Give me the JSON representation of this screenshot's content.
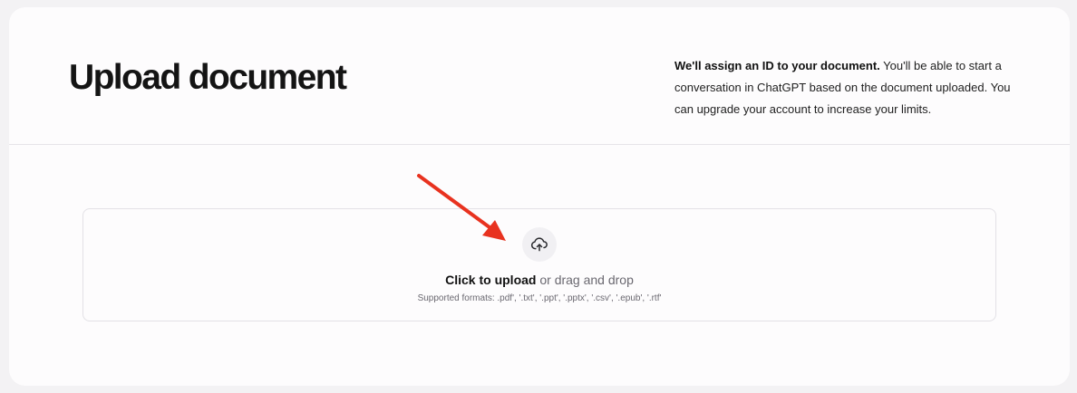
{
  "header": {
    "title": "Upload document",
    "description_bold": "We'll assign an ID to your document.",
    "description_rest": " You'll be able to start a conversation in ChatGPT based on the document uploaded. You can upgrade your account to increase your limits."
  },
  "dropzone": {
    "icon": "upload-cloud-icon",
    "click_label": "Click to upload",
    "drag_label": " or drag and drop",
    "formats": "Supported formats: .pdf', '.txt', '.ppt', '.pptx', '.csv', '.epub', '.rtf'"
  },
  "annotation": {
    "icon": "red-arrow-icon",
    "color": "#e8321f"
  }
}
